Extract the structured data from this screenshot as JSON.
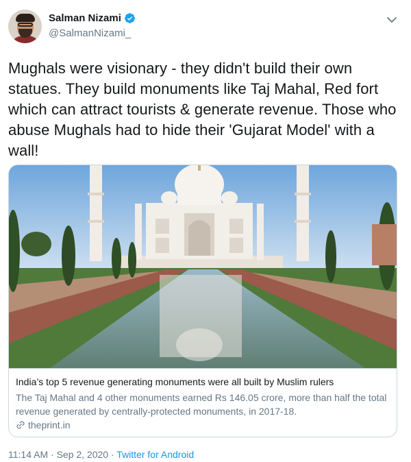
{
  "author": {
    "display_name": "Salman Nizami",
    "handle": "@SalmanNizami_",
    "verified": true
  },
  "tweet": {
    "text": "Mughals were visionary - they didn't build their own statues. They build monuments like Taj Mahal, Red fort which can attract tourists & generate revenue. Those who abuse Mughals had to hide their 'Gujarat Model' with a wall!"
  },
  "card": {
    "title": "India’s top 5 revenue generating monuments were all built by Muslim rulers",
    "description": "The Taj Mahal and 4 other monuments earned Rs 146.05 crore, more than half the total revenue generated by centrally-protected monuments, in 2017-18.",
    "domain": "theprint.in",
    "link_icon": "link-icon"
  },
  "meta": {
    "time": "11:14 AM",
    "separator1": " · ",
    "date": "Sep 2, 2020",
    "separator2": " · ",
    "source": "Twitter for Android"
  },
  "icons": {
    "verified": "verified-badge-icon",
    "caret": "chevron-down-icon"
  },
  "colors": {
    "link_blue": "#1b95e0",
    "verified_blue": "#1da1f2",
    "secondary_text": "#657786",
    "border": "#ccd6dd"
  }
}
